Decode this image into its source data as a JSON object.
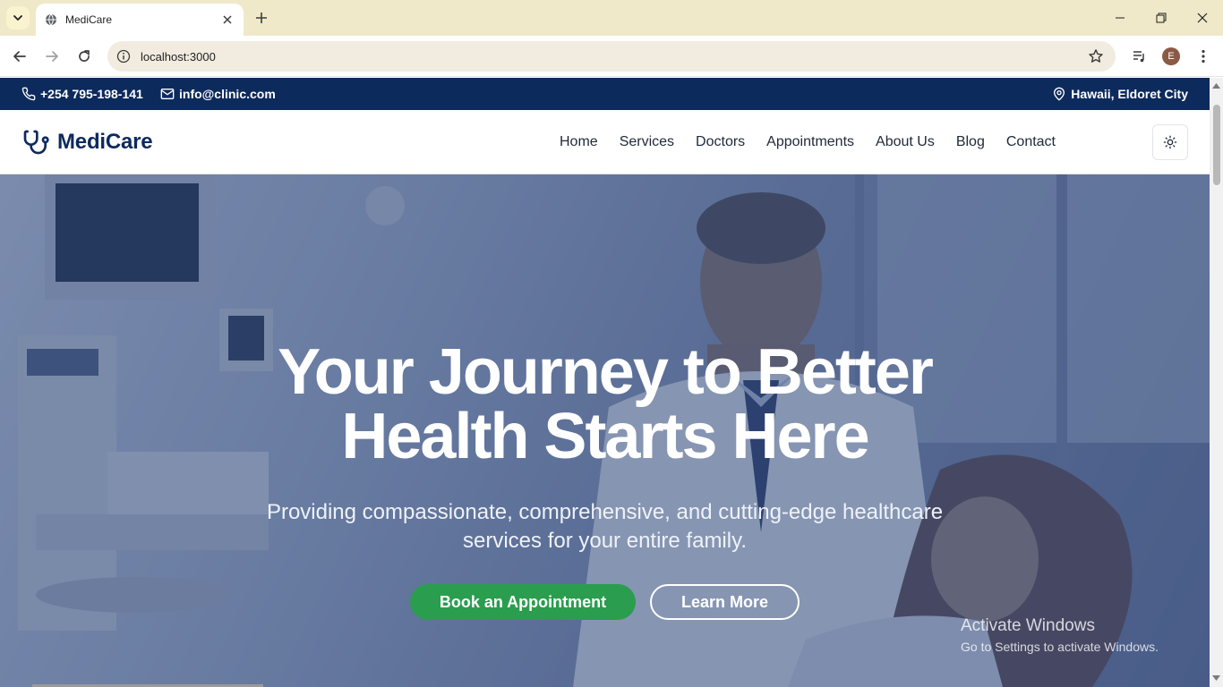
{
  "browser": {
    "tab_title": "MediCare",
    "url": "localhost:3000",
    "profile_initial": "E",
    "icons": [
      "chevron-down-icon",
      "globe-icon",
      "close-icon",
      "plus-icon",
      "minimize-icon",
      "restore-icon",
      "close-window-icon",
      "back-icon",
      "forward-icon",
      "reload-icon",
      "info-icon",
      "star-icon",
      "media-icon",
      "kebab-menu-icon"
    ]
  },
  "topbar": {
    "phone": "+254 795-198-141",
    "email": "info@clinic.com",
    "location": "Hawaii, Eldoret City"
  },
  "navbar": {
    "brand": "MediCare",
    "links": [
      "Home",
      "Services",
      "Doctors",
      "Appointments",
      "About Us",
      "Blog",
      "Contact"
    ]
  },
  "hero": {
    "title_lines": [
      "Your Journey to Better",
      "Health Starts Here"
    ],
    "subtitle_lines": [
      "Providing compassionate, comprehensive, and cutting-edge healthcare",
      "services for your entire family."
    ],
    "primary_cta": "Book an Appointment",
    "secondary_cta": "Learn More"
  },
  "watermark": {
    "title": "Activate Windows",
    "subtitle": "Go to Settings to activate Windows."
  },
  "colors": {
    "topbar_bg": "#0d2a5c",
    "brand": "#0d2a5c",
    "primary_cta": "#2a9d4f",
    "tabstrip_bg": "#efe9c9"
  }
}
